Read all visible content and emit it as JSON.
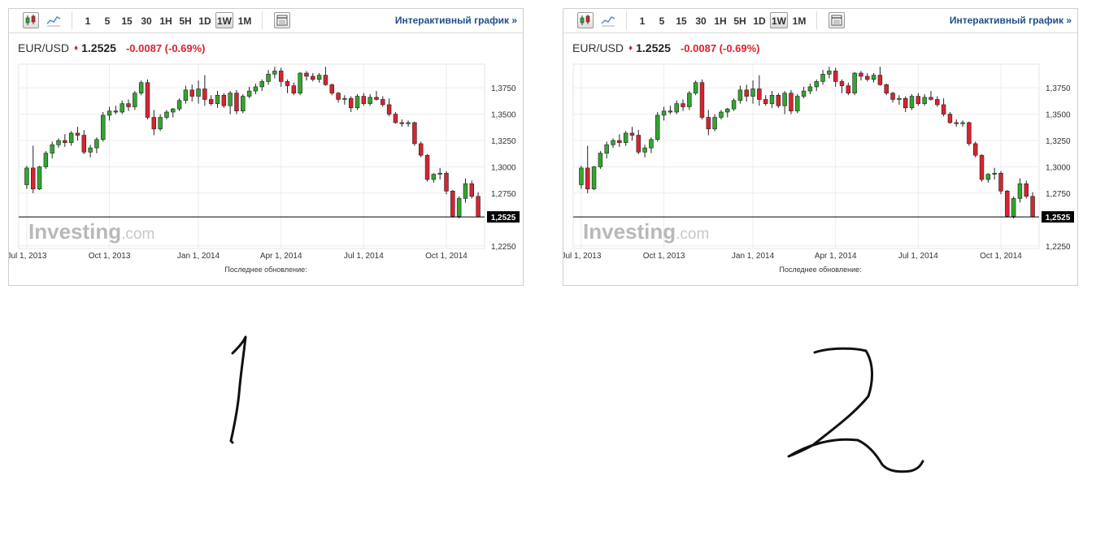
{
  "toolbar": {
    "timeframes": [
      "1",
      "5",
      "15",
      "30",
      "1H",
      "5H",
      "1D",
      "1W",
      "1M"
    ],
    "active_timeframe": "1W",
    "interactive_label": "Интерактивный график »"
  },
  "quote": {
    "symbol": "EUR/USD",
    "price": "1.2525",
    "change": "-0.0087 (-0.69%)"
  },
  "watermark": {
    "brand": "Investing",
    "domain": ".com"
  },
  "footer": {
    "last_update": "Последнее обновление:"
  },
  "price_label": "1,2525",
  "handwritten_numbers": [
    "1",
    "2"
  ],
  "colors": {
    "up": "#31a62e",
    "down": "#d9232f",
    "link": "#1f4f8c"
  },
  "chart_data": [
    {
      "type": "candlestick",
      "y_ticks": [
        "1,3750",
        "1,3500",
        "1,3250",
        "1,3000",
        "1,2750",
        "1,2250"
      ],
      "ylim": [
        1.2225,
        1.3975
      ],
      "x_ticks": [
        "Jul 1, 2013",
        "Oct 1, 2013",
        "Jan 1, 2014",
        "Apr 1, 2014",
        "Jul 1, 2014",
        "Oct 1, 2014"
      ],
      "current_price": 1.2525,
      "candles": [
        [
          1.283,
          1.301,
          1.279,
          1.2989
        ],
        [
          1.2989,
          1.32,
          1.275,
          1.279
        ],
        [
          1.279,
          1.301,
          1.278,
          1.3
        ],
        [
          1.3,
          1.315,
          1.298,
          1.313
        ],
        [
          1.313,
          1.324,
          1.308,
          1.321
        ],
        [
          1.321,
          1.327,
          1.318,
          1.325
        ],
        [
          1.325,
          1.331,
          1.319,
          1.323
        ],
        [
          1.323,
          1.334,
          1.32,
          1.332
        ],
        [
          1.332,
          1.338,
          1.325,
          1.33
        ],
        [
          1.33,
          1.335,
          1.312,
          1.314
        ],
        [
          1.314,
          1.321,
          1.309,
          1.318
        ],
        [
          1.318,
          1.328,
          1.313,
          1.326
        ],
        [
          1.326,
          1.352,
          1.324,
          1.349
        ],
        [
          1.349,
          1.357,
          1.344,
          1.353
        ],
        [
          1.353,
          1.358,
          1.35,
          1.352
        ],
        [
          1.352,
          1.363,
          1.35,
          1.36
        ],
        [
          1.36,
          1.364,
          1.353,
          1.357
        ],
        [
          1.357,
          1.372,
          1.354,
          1.37
        ],
        [
          1.37,
          1.382,
          1.368,
          1.38
        ],
        [
          1.38,
          1.383,
          1.345,
          1.347
        ],
        [
          1.347,
          1.354,
          1.33,
          1.336
        ],
        [
          1.336,
          1.35,
          1.334,
          1.347
        ],
        [
          1.347,
          1.354,
          1.345,
          1.352
        ],
        [
          1.352,
          1.356,
          1.347,
          1.355
        ],
        [
          1.355,
          1.365,
          1.353,
          1.363
        ],
        [
          1.363,
          1.377,
          1.36,
          1.373
        ],
        [
          1.373,
          1.378,
          1.362,
          1.367
        ],
        [
          1.367,
          1.382,
          1.36,
          1.374
        ],
        [
          1.374,
          1.387,
          1.358,
          1.364
        ],
        [
          1.364,
          1.368,
          1.358,
          1.36
        ],
        [
          1.36,
          1.372,
          1.356,
          1.368
        ],
        [
          1.368,
          1.37,
          1.356,
          1.358
        ],
        [
          1.358,
          1.372,
          1.35,
          1.37
        ],
        [
          1.37,
          1.373,
          1.35,
          1.353
        ],
        [
          1.353,
          1.369,
          1.351,
          1.367
        ],
        [
          1.367,
          1.376,
          1.365,
          1.372
        ],
        [
          1.372,
          1.379,
          1.369,
          1.376
        ],
        [
          1.376,
          1.383,
          1.372,
          1.381
        ],
        [
          1.381,
          1.392,
          1.378,
          1.388
        ],
        [
          1.388,
          1.395,
          1.384,
          1.391
        ],
        [
          1.391,
          1.394,
          1.376,
          1.381
        ],
        [
          1.381,
          1.383,
          1.37,
          1.377
        ],
        [
          1.377,
          1.38,
          1.368,
          1.37
        ],
        [
          1.37,
          1.39,
          1.368,
          1.389
        ],
        [
          1.389,
          1.391,
          1.382,
          1.386
        ],
        [
          1.386,
          1.389,
          1.381,
          1.383
        ],
        [
          1.383,
          1.389,
          1.38,
          1.387
        ],
        [
          1.387,
          1.395,
          1.377,
          1.378
        ],
        [
          1.378,
          1.379,
          1.368,
          1.37
        ],
        [
          1.37,
          1.371,
          1.361,
          1.364
        ],
        [
          1.364,
          1.368,
          1.359,
          1.365
        ],
        [
          1.365,
          1.367,
          1.352,
          1.356
        ],
        [
          1.356,
          1.369,
          1.354,
          1.367
        ],
        [
          1.367,
          1.37,
          1.358,
          1.36
        ],
        [
          1.36,
          1.369,
          1.358,
          1.366
        ],
        [
          1.366,
          1.372,
          1.363,
          1.364
        ],
        [
          1.364,
          1.367,
          1.357,
          1.359
        ],
        [
          1.359,
          1.365,
          1.348,
          1.35
        ],
        [
          1.35,
          1.352,
          1.341,
          1.342
        ],
        [
          1.342,
          1.345,
          1.338,
          1.341
        ],
        [
          1.341,
          1.344,
          1.338,
          1.342
        ],
        [
          1.342,
          1.343,
          1.32,
          1.322
        ],
        [
          1.322,
          1.324,
          1.309,
          1.311
        ],
        [
          1.311,
          1.312,
          1.286,
          1.288
        ],
        [
          1.288,
          1.294,
          1.285,
          1.293
        ],
        [
          1.293,
          1.299,
          1.288,
          1.294
        ],
        [
          1.294,
          1.296,
          1.274,
          1.277
        ],
        [
          1.277,
          1.278,
          1.252,
          1.253
        ],
        [
          1.253,
          1.272,
          1.251,
          1.27
        ],
        [
          1.27,
          1.289,
          1.266,
          1.284
        ],
        [
          1.284,
          1.287,
          1.27,
          1.272
        ],
        [
          1.272,
          1.276,
          1.252,
          1.2525
        ]
      ]
    },
    {
      "type": "candlestick",
      "y_ticks": [
        "1,3750",
        "1,3500",
        "1,3250",
        "1,3000",
        "1,2750",
        "1,2250"
      ],
      "ylim": [
        1.2225,
        1.3975
      ],
      "x_ticks": [
        "Jul 1, 2013",
        "Oct 1, 2013",
        "Jan 1, 2014",
        "Apr 1, 2014",
        "Jul 1, 2014",
        "Oct 1, 2014"
      ],
      "current_price": 1.2525,
      "candles": "same"
    }
  ]
}
